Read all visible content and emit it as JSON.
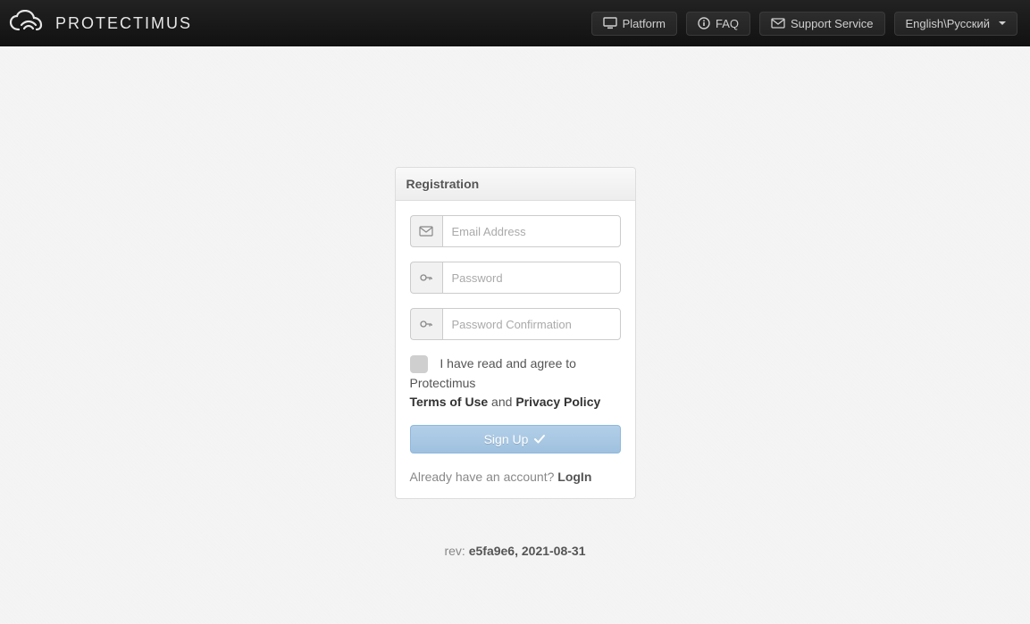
{
  "brand": {
    "name": "PROTECTIMUS"
  },
  "nav": {
    "platform_label": "Platform",
    "faq_label": "FAQ",
    "support_label": "Support Service",
    "language_label": "English\\Русский"
  },
  "panel": {
    "title": "Registration",
    "email_placeholder": "Email Address",
    "password_placeholder": "Password",
    "password_confirm_placeholder": "Password Confirmation",
    "email_value": "",
    "password_value": "",
    "password_confirm_value": ""
  },
  "consent": {
    "prefix": "I have read and agree to Protectimus",
    "terms_label": "Terms of Use",
    "and": " and ",
    "privacy_label": "Privacy Policy",
    "checked": false
  },
  "actions": {
    "signup_label": "Sign Up"
  },
  "login_prompt": {
    "text": "Already have an account? ",
    "login_label": "LogIn"
  },
  "footer": {
    "rev_prefix": "rev: ",
    "rev_value": "e5fa9e6, 2021-08-31"
  }
}
